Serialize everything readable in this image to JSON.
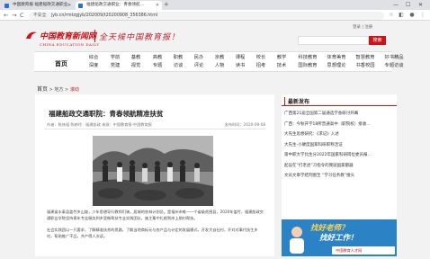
{
  "browser": {
    "tabs": [
      {
        "title": "中国教育报 福建船政交通职业…"
      },
      {
        "title": "福建船政交通职业：青春领航…"
      }
    ],
    "new_tab": "+",
    "window_controls": [
      "—",
      "☐",
      "✕"
    ],
    "back": "←",
    "forward": "→",
    "reload": "C",
    "security_label": "不安全",
    "url": "jyb.cn/rmtzgjyb/202009/t20200908_356386.html"
  },
  "site": {
    "top_links": "登录 | 注册",
    "logo_title": "中国教育新闻网",
    "logo_subtitle": "CHINA EDUCATION DAILY",
    "slogan": "全天候中国教育报！",
    "search_button": "搜索"
  },
  "nav": {
    "home": "首页",
    "columns": [
      {
        "top": "综合",
        "bottom": "深度"
      },
      {
        "top": "学前",
        "bottom": "党建"
      },
      {
        "top": "基教",
        "bottom": "视觉"
      },
      {
        "top": "高教",
        "bottom": "专题"
      },
      {
        "top": "职教",
        "bottom": "访谈"
      },
      {
        "top": "民办",
        "bottom": "评论"
      },
      {
        "top": "京教",
        "bottom": "人物"
      },
      {
        "top": "课程",
        "bottom": "读书"
      },
      {
        "top": "校长",
        "bottom": "招考"
      },
      {
        "top": "教学",
        "bottom": "技术"
      },
      {
        "top": "科技教育",
        "bottom": "国际教育"
      },
      {
        "top": "体育美育",
        "bottom": "思想理论"
      },
      {
        "top": "智慧教育",
        "bottom": "书香校园"
      },
      {
        "top": "好书精品",
        "bottom": "专题访谈"
      }
    ]
  },
  "breadcrumb": {
    "home": "首页",
    "sep": ">",
    "level1": "地方",
    "level2": "滚动"
  },
  "article": {
    "title": "福建船政交通职院：青春领航精准扶贫",
    "meta": "作者：陈炜祖 陈婷玲 · 福建船政   来源：中国教育报·中国教育报",
    "date": "发布时间：2020-09-08",
    "para1": "福建省水泰县盖竹乡山坡，少年思想导行教师们骑，居城的农林计划员。是福州市唯一一个省级贫困县，2020年盖竹，福建船政交通职业学院坚持青年专业服务到乡里做帮扶专业实践团队，施主集中扎根到岸上助村帮扶。",
    "para2": "社会实践团以一只要求，了解精准扶贫的思路，了解当地商标元与农产品与计定的发展模式，开发大自社村，开对对事代扶生乡村，帮助推广干品，共产得人次读。"
  },
  "sidebar": {
    "title": "最新发布",
    "items": [
      "广西第21届全国第二届通选学会研讨开幕",
      "广西：今秋开学18所普通高中（职院校）接收…",
      "大先生思想研究：《求记》入述",
      "大先生-小硬度国家科研职称活证",
      "第中职大学比生分2022年国家科研岗位委员报…",
      "起设在“打老虎”习指令的我就国家都器",
      "文员文章学结列图至 “学习任务教”搜头"
    ],
    "ad": {
      "line1": "找好老师？",
      "line2": "找好工作！",
      "brand": "中国教育人才网"
    }
  }
}
